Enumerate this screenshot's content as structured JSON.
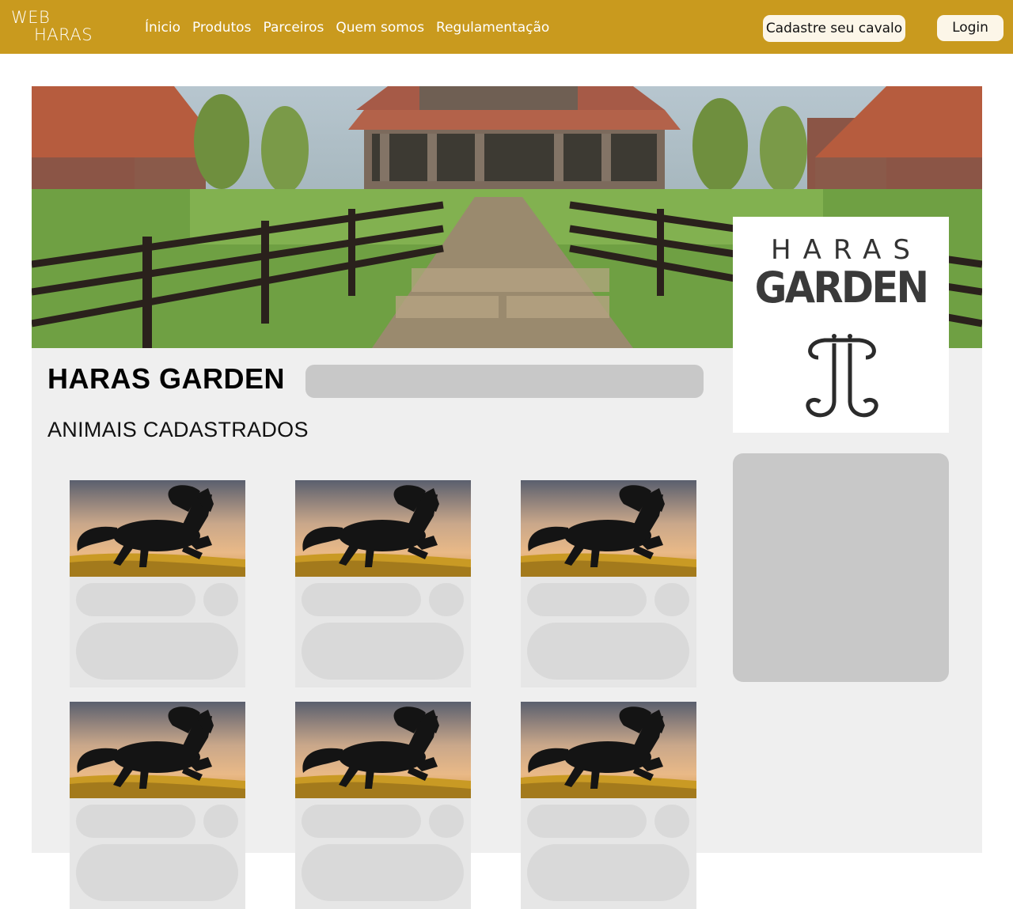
{
  "brand": {
    "line1": "WEB",
    "line2": "HARAS"
  },
  "nav": {
    "links": [
      "Ínicio",
      "Produtos",
      "Parceiros",
      "Quem somos",
      "Regulamentação"
    ],
    "register_button": "Cadastre seu cavalo",
    "login_button": "Login"
  },
  "farm": {
    "name": "HARAS GARDEN",
    "logo_line1": "HARAS",
    "logo_line2": "GARDEN",
    "section_title": "ANIMAIS CADASTRADOS"
  },
  "colors": {
    "accent": "#c99a1e",
    "panel": "#efefef",
    "placeholder": "#c8c8c8"
  }
}
